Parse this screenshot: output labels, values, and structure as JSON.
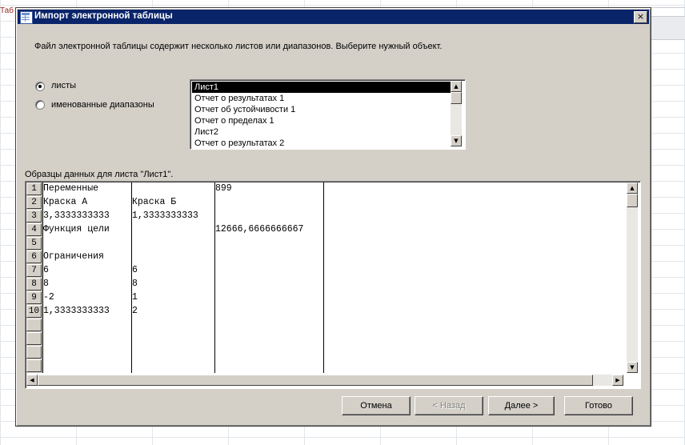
{
  "background": {
    "tab_label": "Таб"
  },
  "dialog": {
    "title": "Импорт электронной таблицы",
    "close_label": "×",
    "intro": "Файл электронной таблицы содержит несколько листов или диапазонов.  Выберите нужный объект.",
    "radio_sheets": "листы",
    "radio_ranges": "именованные диапазоны",
    "objects": [
      "Лист1",
      "Отчет о результатах 1",
      "Отчет об устойчивости 1",
      "Отчет о пределах 1",
      "Лист2",
      "Отчет о результатах 2"
    ],
    "selected_object": "Лист1",
    "preview_caption": "Образцы данных для листа \"Лист1\"."
  },
  "preview": {
    "row_numbers": [
      "1",
      "2",
      "3",
      "4",
      "5",
      "6",
      "7",
      "8",
      "9",
      "10"
    ],
    "rows": [
      [
        "Переменные",
        "",
        "899"
      ],
      [
        "Краска А",
        "Краска Б",
        ""
      ],
      [
        "3,3333333333",
        "1,3333333333",
        ""
      ],
      [
        "Функция цели",
        "",
        "12666,6666666667"
      ],
      [
        "",
        "",
        ""
      ],
      [
        "Ограничения",
        "",
        ""
      ],
      [
        "6",
        "6",
        ""
      ],
      [
        "8",
        "8",
        ""
      ],
      [
        "-2",
        "1",
        ""
      ],
      [
        "1,3333333333",
        "2",
        ""
      ]
    ]
  },
  "buttons": {
    "cancel": "Отмена",
    "back": "< Назад",
    "next": "Далее >",
    "finish": "Готово"
  },
  "colors": {
    "titlebar": "#0a246a",
    "dialog_face": "#d4d0c8",
    "selection": "#000000"
  },
  "icons": [
    "table-icon",
    "close-icon",
    "scroll-up-icon",
    "scroll-down-icon",
    "scroll-left-icon",
    "scroll-right-icon"
  ]
}
